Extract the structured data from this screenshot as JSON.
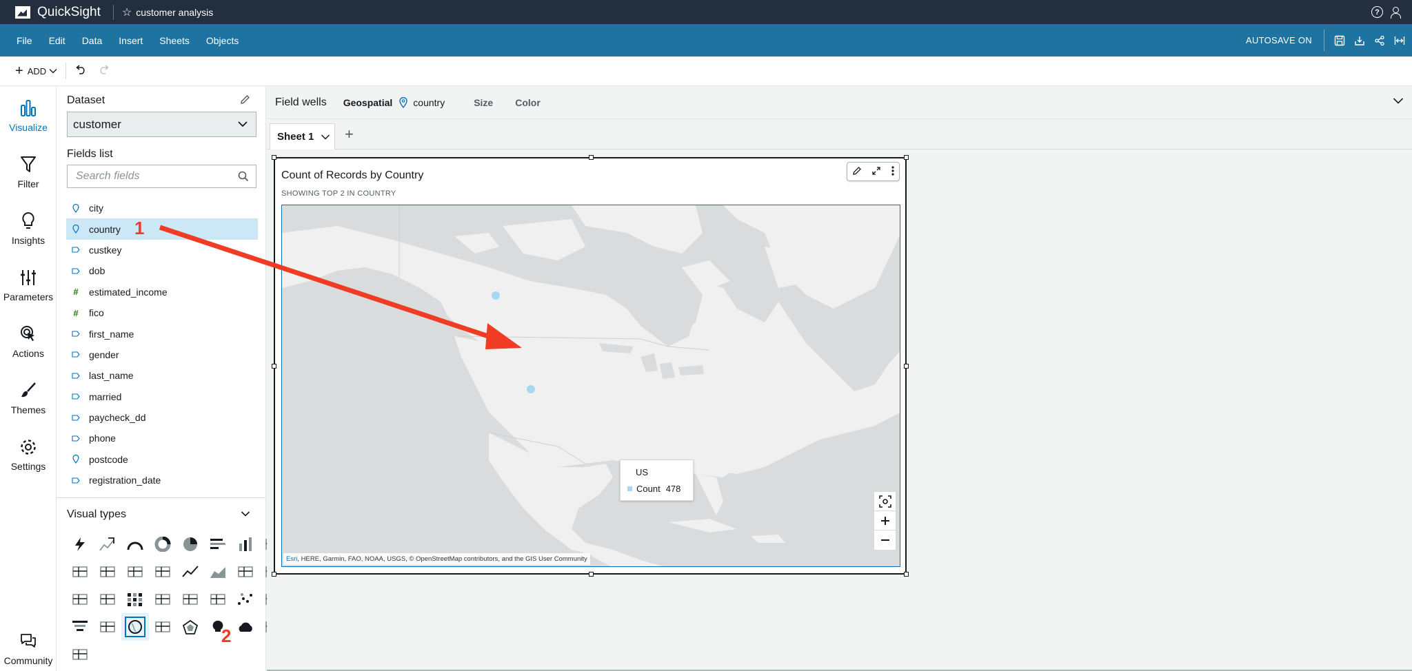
{
  "titlebar": {
    "brand": "QuickSight",
    "analysis_name": "customer analysis"
  },
  "menubar": {
    "items": [
      "File",
      "Edit",
      "Data",
      "Insert",
      "Sheets",
      "Objects"
    ],
    "autosave": "AUTOSAVE ON"
  },
  "toolbar": {
    "add_label": "ADD"
  },
  "leftnav": {
    "items": [
      {
        "label": "Visualize",
        "icon": "bar-chart-icon",
        "active": true
      },
      {
        "label": "Filter",
        "icon": "funnel-icon"
      },
      {
        "label": "Insights",
        "icon": "lightbulb-icon"
      },
      {
        "label": "Parameters",
        "icon": "sliders-icon"
      },
      {
        "label": "Actions",
        "icon": "cursor-click-icon"
      },
      {
        "label": "Themes",
        "icon": "brush-icon"
      },
      {
        "label": "Settings",
        "icon": "gear-icon"
      },
      {
        "label": "Community",
        "icon": "chat-bubbles-icon"
      }
    ]
  },
  "datapanel": {
    "dataset_title": "Dataset",
    "dataset_value": "customer",
    "fields_title": "Fields list",
    "search_placeholder": "Search fields",
    "fields": [
      {
        "name": "city",
        "type": "geo"
      },
      {
        "name": "country",
        "type": "geo",
        "selected": true
      },
      {
        "name": "custkey",
        "type": "dimension"
      },
      {
        "name": "dob",
        "type": "dimension"
      },
      {
        "name": "estimated_income",
        "type": "measure"
      },
      {
        "name": "fico",
        "type": "measure"
      },
      {
        "name": "first_name",
        "type": "dimension"
      },
      {
        "name": "gender",
        "type": "dimension"
      },
      {
        "name": "last_name",
        "type": "dimension"
      },
      {
        "name": "married",
        "type": "dimension"
      },
      {
        "name": "paycheck_dd",
        "type": "dimension"
      },
      {
        "name": "phone",
        "type": "dimension"
      },
      {
        "name": "postcode",
        "type": "geo"
      },
      {
        "name": "registration_date",
        "type": "dimension"
      }
    ],
    "visual_types_title": "Visual types"
  },
  "fieldwells": {
    "label": "Field wells",
    "geospatial_label": "Geospatial",
    "geospatial_value": "country",
    "size_label": "Size",
    "color_label": "Color"
  },
  "sheets": {
    "active": "Sheet 1"
  },
  "visual": {
    "title": "Count of Records by Country",
    "subtitle": "SHOWING TOP 2 IN COUNTRY",
    "attribution_esri": "Esri",
    "attribution_rest": ", HERE, Garmin, FAO, NOAA, USGS, © OpenStreetMap contributors, and the GIS User Community",
    "tooltip": {
      "title": "US",
      "metric": "Count",
      "value": "478"
    }
  },
  "annotations": {
    "step1": "1",
    "step2": "2",
    "arrow_color": "#f03c24"
  },
  "colors": {
    "titlebar": "#232f3e",
    "menubar": "#1e73a0",
    "accent": "#0073bb",
    "selected_field": "#cce7f6",
    "map_dot": "#a7d8ef"
  }
}
